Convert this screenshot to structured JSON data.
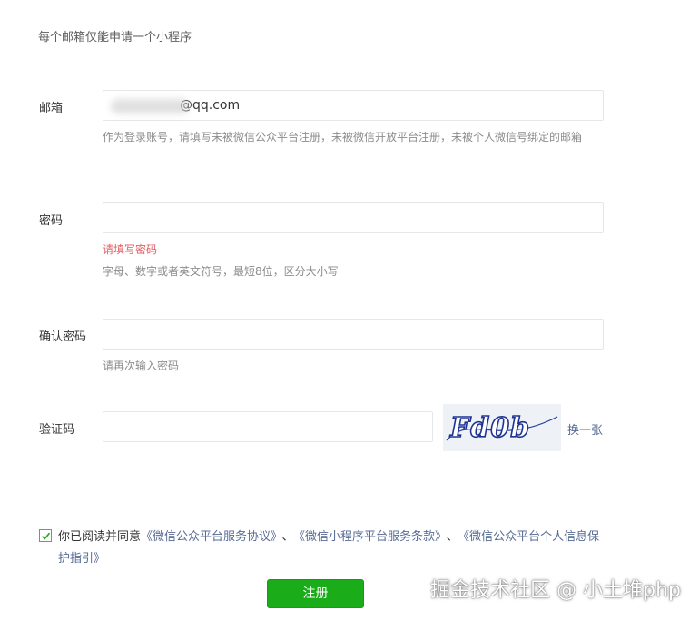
{
  "notice": "每个邮箱仅能申请一个小程序",
  "email": {
    "label": "邮箱",
    "value": "@qq.com",
    "hint": "作为登录账号，请填写未被微信公众平台注册，未被微信开放平台注册，未被个人微信号绑定的邮箱"
  },
  "password": {
    "label": "密码",
    "error": "请填写密码",
    "hint": "字母、数字或者英文符号，最短8位，区分大小写"
  },
  "confirm_password": {
    "label": "确认密码",
    "hint": "请再次输入密码"
  },
  "captcha": {
    "label": "验证码",
    "image_text": "Fd0b",
    "refresh": "换一张"
  },
  "agreement": {
    "checked": true,
    "prefix": "你已阅读并同意",
    "link1": "《微信公众平台服务协议》",
    "sep1": "、",
    "link2": "《微信小程序平台服务条款》",
    "sep2": "、",
    "link3": "《微信公众平台个人信息保护指引》"
  },
  "submit": "注册",
  "watermark": "掘金技术社区 @ 小土堆php",
  "colors": {
    "primary_button": "#1aad19",
    "link": "#576b95",
    "error": "#e15f63",
    "hint": "#8d8d8d"
  }
}
